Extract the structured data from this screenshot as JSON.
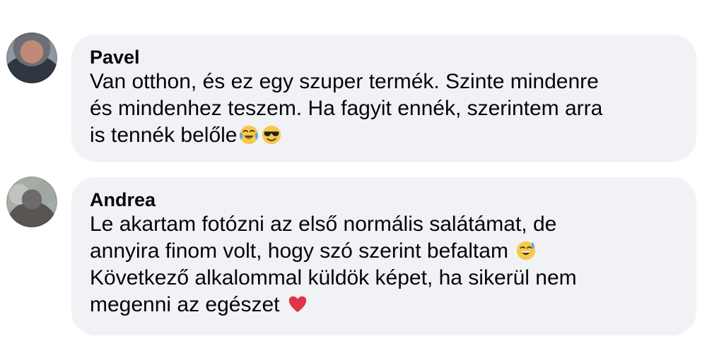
{
  "comments": [
    {
      "author": "Pavel",
      "lines": [
        "Van otthon, és ez egy szuper termék. Szinte mindenre",
        "és mindenhez teszem. Ha fagyit ennék, szerintem arra",
        "is tennék belőle"
      ],
      "emojis": [
        "tears-of-joy-emoji",
        "sunglasses-emoji"
      ]
    },
    {
      "author": "Andrea",
      "lines": [
        "Le akartam fotózni az első normális salátámat, de",
        "annyira finom volt, hogy szó szerint befaltam",
        "Következő alkalommal küldök képet, ha sikerül nem",
        "megenni az egészet"
      ],
      "emojis": [
        "sweat-smile-emoji",
        "red-heart-emoji"
      ]
    }
  ],
  "colors": {
    "bubble_background": "#f0f2f5",
    "text": "#050505"
  }
}
